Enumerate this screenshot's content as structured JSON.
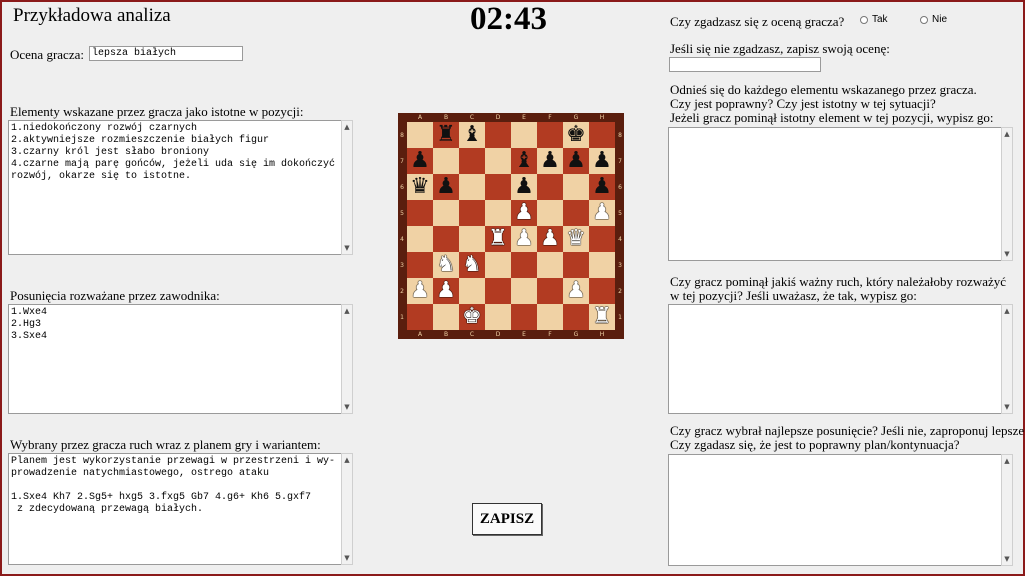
{
  "header": {
    "title": "Przykładowa analiza",
    "timer": "02:43"
  },
  "rating": {
    "label": "Ocena gracza:",
    "value": "lepsza białych"
  },
  "elements": {
    "label": "Elementy wskazane przez gracza jako istotne w pozycji:",
    "text": "1.niedokończony rozwój czarnych\n2.aktywniejsze rozmieszczenie białych figur\n3.czarny król jest słabo broniony\n4.czarne mają parę gońców, jeżeli uda się im dokończyć rozwój, okarze się to istotne."
  },
  "moves": {
    "label": "Posunięcia rozważane przez zawodnika:",
    "text": "1.Wxe4\n2.Hg3\n3.Sxe4"
  },
  "chosen": {
    "label": "Wybrany przez gracza ruch wraz z planem gry i wariantem:",
    "text": "Planem jest wykorzystanie przewagi w przestrzeni i wy-\nprowadzenie natychmiastowego, ostrego ataku\n\n1.Sxe4 Kh7 2.Sg5+ hxg5 3.fxg5 Gb7 4.g6+ Kh6 5.gxf7\n z zdecydowaną przewagą białych."
  },
  "agree": {
    "question": "Czy zgadzasz się z oceną gracza?",
    "options": [
      "Tak",
      "Nie"
    ],
    "own_label": "Jeśli się nie zgadzasz, zapisz swoją ocenę:",
    "own_value": ""
  },
  "refer": {
    "line1": "Odnieś się do każdego elementu wskazanego przez gracza.",
    "line2": "Czy jest poprawny? Czy jest istotny w tej sytuacji?",
    "line3": "Jeżeli gracz pominął istotny element w tej pozycji, wypisz go:",
    "text": ""
  },
  "missed": {
    "line1": "Czy gracz pominął jakiś ważny ruch, który należałoby rozważyć",
    "line2": "w tej pozycji? Jeśli uważasz, że tak, wypisz go:",
    "text": ""
  },
  "best": {
    "line1": "Czy gracz wybrał najlepsze posunięcie? Jeśli nie, zaproponuj lepsze.",
    "line2": "Czy zgadasz się, że jest to poprawny plan/kontynuacja?",
    "text": ""
  },
  "save_button": "ZAPISZ",
  "board": {
    "files": [
      "A",
      "B",
      "C",
      "D",
      "E",
      "F",
      "G",
      "H"
    ],
    "ranks": [
      "8",
      "7",
      "6",
      "5",
      "4",
      "3",
      "2",
      "1"
    ],
    "rows": [
      [
        "",
        "r",
        "b",
        "",
        "",
        "",
        "k",
        ""
      ],
      [
        "p",
        "",
        "",
        "",
        "b",
        "p",
        "p",
        "p"
      ],
      [
        "q",
        "p",
        "",
        "",
        "p",
        "",
        "",
        "p"
      ],
      [
        "",
        "",
        "",
        "",
        "P",
        "",
        "",
        "P"
      ],
      [
        "",
        "",
        "",
        "R",
        "P",
        "P",
        "Q",
        ""
      ],
      [
        "",
        "N",
        "N",
        "",
        "",
        "",
        "",
        ""
      ],
      [
        "P",
        "P",
        "",
        "",
        "",
        "",
        "P",
        ""
      ],
      [
        "",
        "",
        "K",
        "",
        "",
        "",
        "",
        "R"
      ]
    ]
  }
}
